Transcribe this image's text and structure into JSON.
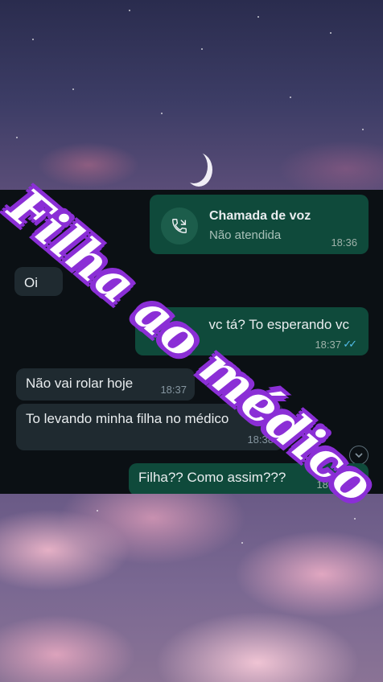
{
  "overlay_title": "Filha ao médico",
  "call": {
    "title": "Chamada de voz",
    "status": "Não atendida",
    "time": "18:36"
  },
  "messages": [
    {
      "text": "Oi",
      "time": "",
      "direction": "in"
    },
    {
      "text": "vc tá? To esperando vc",
      "time": "18:37",
      "direction": "out"
    },
    {
      "text": "Não vai rolar hoje",
      "time": "18:37",
      "direction": "in"
    },
    {
      "text": "To levando minha filha no médico",
      "time": "18:38",
      "direction": "in"
    },
    {
      "text": "Filha?? Como assim???",
      "time": "18:38",
      "direction": "out"
    }
  ],
  "icons": {
    "call": "phone-missed-icon",
    "read_receipt": "double-check-icon",
    "scroll_down": "chevron-down-icon"
  },
  "colors": {
    "accent_outline": "#8b2fd6",
    "outgoing_bubble": "#0f4a3b",
    "incoming_bubble": "#1f2a30",
    "read_ticks": "#53bdeb"
  }
}
